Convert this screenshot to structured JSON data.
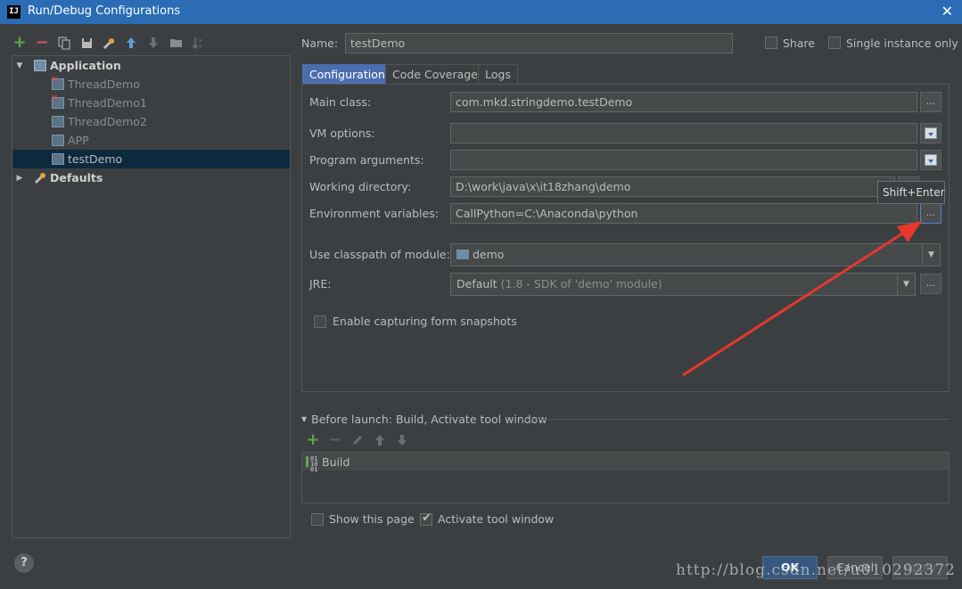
{
  "window": {
    "app_icon_text": "IJ",
    "title": "Run/Debug Configurations",
    "close_symbol": "✕"
  },
  "left_toolbar": {
    "icons": [
      "add-icon",
      "remove-icon",
      "copy-icon",
      "save-icon",
      "wrench-icon",
      "move-up-icon",
      "move-down-icon",
      "folder-icon",
      "sort-icon"
    ]
  },
  "tree": {
    "application_label": "Application",
    "items": [
      {
        "label": "ThreadDemo",
        "has_error": true
      },
      {
        "label": "ThreadDemo1",
        "has_error": true
      },
      {
        "label": "ThreadDemo2",
        "has_error": false
      },
      {
        "label": "APP",
        "has_error": false
      },
      {
        "label": "testDemo",
        "has_error": false,
        "selected": true
      }
    ],
    "defaults_label": "Defaults"
  },
  "header": {
    "name_label": "Name:",
    "name_value": "testDemo",
    "share_label": "Share",
    "single_instance_label": "Single instance only"
  },
  "tabs": [
    {
      "label": "Configuration",
      "active": true
    },
    {
      "label": "Code Coverage",
      "active": false
    },
    {
      "label": "Logs",
      "active": false
    }
  ],
  "config": {
    "main_class_label": "Main class:",
    "main_class_value": "com.mkd.stringdemo.testDemo",
    "vm_options_label": "VM options:",
    "vm_options_value": "",
    "program_args_label": "Program arguments:",
    "program_args_value": "",
    "working_dir_label": "Working directory:",
    "working_dir_value": "D:\\work\\java\\x\\it18zhang\\demo",
    "env_vars_label": "Environment variables:",
    "env_vars_value": "CallPython=C:\\Anaconda\\python",
    "classpath_label": "Use classpath of module:",
    "classpath_value": "demo",
    "jre_label": "JRE:",
    "jre_value": "Default",
    "jre_detail": "(1.8 - SDK of 'demo' module)",
    "snapshots_label": "Enable capturing form snapshots",
    "ellipsis": "...",
    "tooltip": "Shift+Enter"
  },
  "before_launch": {
    "title": "Before launch: Build, Activate tool window",
    "items": [
      "Build"
    ]
  },
  "footer": {
    "show_page_label": "Show this page",
    "activate_tool_label": "Activate tool window",
    "activate_tool_checked": true,
    "ok_label": "OK",
    "cancel_label": "Cancel",
    "apply_label": "Apply",
    "help_label": "?"
  },
  "watermark": "http://blog.csdn.net/u010292372",
  "colors": {
    "titlebar": "#2b6cb5",
    "background": "#3c3f41",
    "selection": "#0d293e",
    "active_tab": "#4b6eaf",
    "annotation_arrow": "#e8372c"
  }
}
